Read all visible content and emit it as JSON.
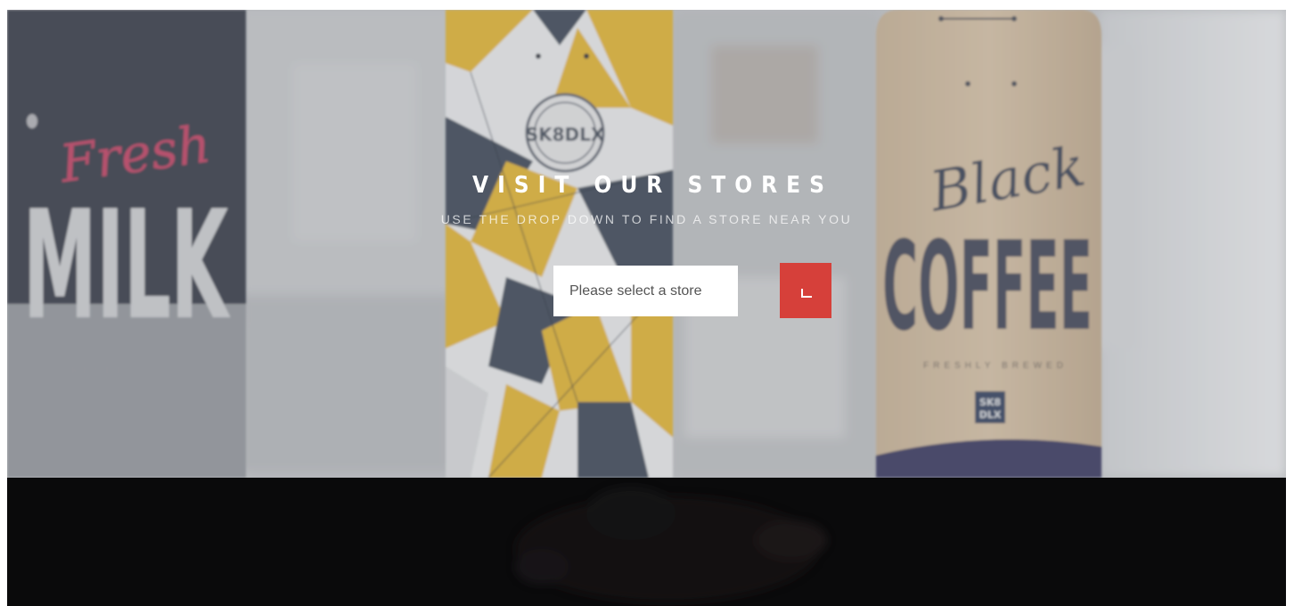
{
  "hero": {
    "title": "VISIT OUR STORES",
    "subtitle": "USE THE DROP DOWN TO FIND A STORE NEAR YOU",
    "background_image_lettering": [
      "Fresh",
      "MILK",
      "SK8DLX",
      "Black",
      "COFFEE",
      "FRESHLY BREWED",
      "SK8 DLX"
    ]
  },
  "store_selector": {
    "placeholder": "Please select a store"
  },
  "go_button": {
    "icon": "corner-arrow-icon"
  },
  "colors": {
    "accent": "#d6403a",
    "dark_section": "#0a0a0b"
  }
}
